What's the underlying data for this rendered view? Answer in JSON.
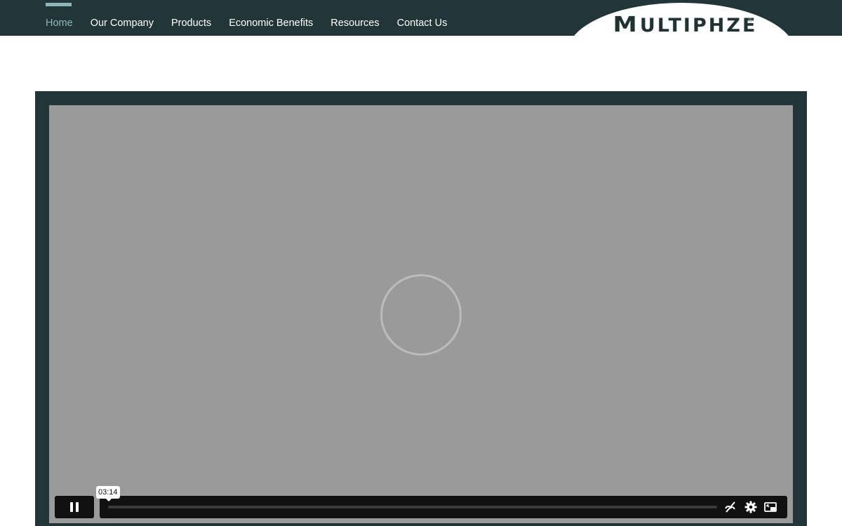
{
  "nav": {
    "items": [
      {
        "label": "Home",
        "active": true
      },
      {
        "label": "Our Company",
        "active": false
      },
      {
        "label": "Products",
        "active": false
      },
      {
        "label": "Economic Benefits",
        "active": false
      },
      {
        "label": "Resources",
        "active": false
      },
      {
        "label": "Contact Us",
        "active": false
      }
    ]
  },
  "logo": {
    "initial": "M",
    "rest": "ULTIPHZE",
    "registered": "®"
  },
  "player": {
    "state": "loading",
    "hover_time": "03:14",
    "progress_fraction": 0.0,
    "controls": {
      "pause_icon": "pause-icon",
      "captions_icon": "captions-off-icon",
      "settings_icon": "gear-icon",
      "pip_icon": "picture-in-picture-icon"
    }
  },
  "colors": {
    "header_bg": "#223538",
    "accent": "#8fb7b9",
    "video_placeholder": "#9a9a9a",
    "control_bg": "#111111"
  }
}
